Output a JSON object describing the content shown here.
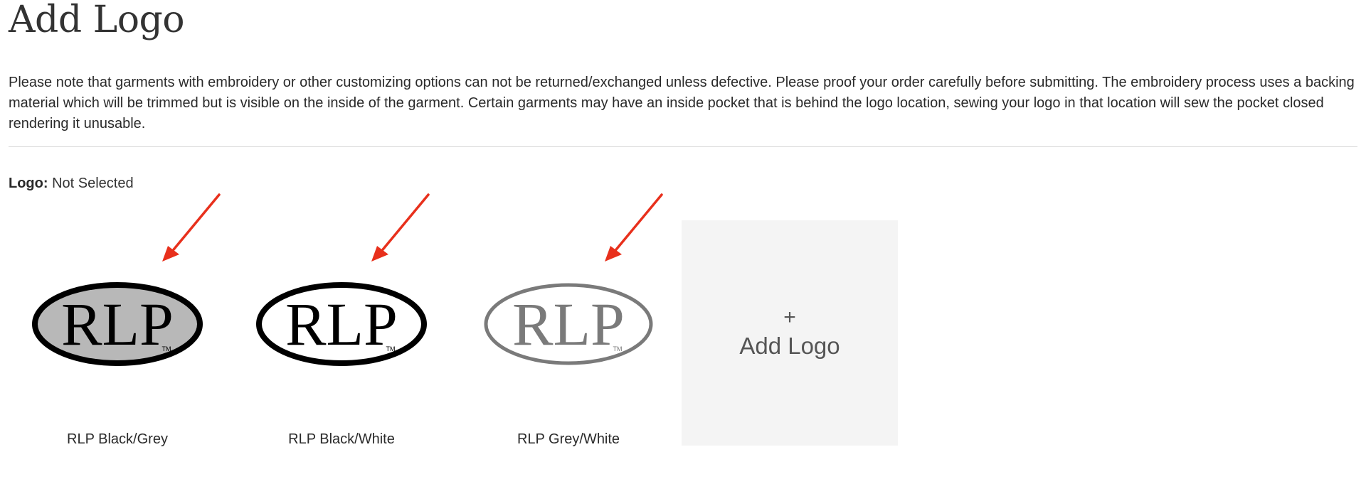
{
  "page": {
    "title": "Add Logo",
    "notice": "Please note that garments with embroidery or other customizing options can not be returned/exchanged unless defective. Please proof your order carefully before submitting. The embroidery process uses a backing material which will be trimmed but is visible on the inside of the garment. Certain garments may have an inside pocket that is behind the logo location, sewing your logo in that location will sew the pocket closed rendering it unusable."
  },
  "logo_status": {
    "label": "Logo:",
    "value": "Not Selected"
  },
  "logo_options": [
    {
      "caption": "RLP Black/Grey",
      "mark": "RLP",
      "tm": "TM",
      "colors": {
        "fill": "#b8b8b8",
        "ring": "#000000",
        "text": "#000000"
      }
    },
    {
      "caption": "RLP Black/White",
      "mark": "RLP",
      "tm": "TM",
      "colors": {
        "fill": "#ffffff",
        "ring": "#000000",
        "text": "#000000"
      }
    },
    {
      "caption": "RLP Grey/White",
      "mark": "RLP",
      "tm": "TM",
      "colors": {
        "fill": "#ffffff",
        "ring": "#7a7a7a",
        "text": "#7a7a7a"
      }
    }
  ],
  "add_logo": {
    "plus": "+",
    "label": "Add Logo"
  },
  "annotation": {
    "arrow_color": "#e8301c"
  }
}
